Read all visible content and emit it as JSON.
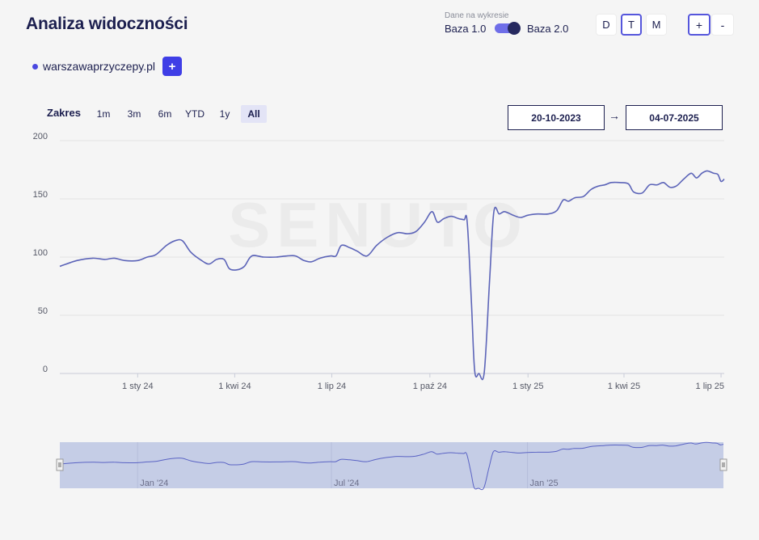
{
  "header": {
    "title": "Analiza widoczności",
    "data_toggle": {
      "caption": "Dane na wykresie",
      "left_label": "Baza 1.0",
      "right_label": "Baza 2.0",
      "selected": "Baza 2.0"
    },
    "period_buttons": [
      "D",
      "T",
      "M"
    ],
    "period_selected": "T",
    "zoom_in_label": "+",
    "zoom_out_label": "-"
  },
  "domains": [
    {
      "name": "warszawaprzyczepy.pl",
      "color": "#4a48e0"
    }
  ],
  "add_domain_label": "+",
  "range": {
    "label": "Zakres",
    "buttons": [
      "1m",
      "3m",
      "6m",
      "YTD",
      "1y",
      "All"
    ],
    "selected": "All",
    "from_date": "20-10-2023",
    "arrow": "→",
    "to_date": "04-07-2025"
  },
  "watermark": "SENUTO",
  "colors": {
    "accent": "#4a48e0",
    "line": "#5c64b8",
    "navigator_fill": "#c5cde6"
  },
  "chart_data": {
    "type": "line",
    "title": "",
    "xlabel": "",
    "ylabel": "",
    "ylim": [
      0,
      200
    ],
    "y_ticks": [
      0,
      50,
      100,
      150,
      200
    ],
    "x_range": [
      "2023-10-20",
      "2025-07-04"
    ],
    "x_ticks": [
      {
        "date": "2024-01-01",
        "label": "1 sty 24"
      },
      {
        "date": "2024-04-01",
        "label": "1 kwi 24"
      },
      {
        "date": "2024-07-01",
        "label": "1 lip 24"
      },
      {
        "date": "2024-10-01",
        "label": "1 paź 24"
      },
      {
        "date": "2025-01-01",
        "label": "1 sty 25"
      },
      {
        "date": "2025-04-01",
        "label": "1 kwi 25"
      },
      {
        "date": "2025-07-01",
        "label": "1 lip 25"
      }
    ],
    "grid": true,
    "series": [
      {
        "name": "warszawaprzyczepy.pl",
        "points": [
          [
            "2023-10-20",
            92
          ],
          [
            "2023-11-05",
            97
          ],
          [
            "2023-11-20",
            99
          ],
          [
            "2023-12-01",
            98
          ],
          [
            "2023-12-10",
            99
          ],
          [
            "2023-12-20",
            97
          ],
          [
            "2024-01-01",
            97
          ],
          [
            "2024-01-10",
            100
          ],
          [
            "2024-01-18",
            102
          ],
          [
            "2024-01-28",
            110
          ],
          [
            "2024-02-05",
            114
          ],
          [
            "2024-02-12",
            114
          ],
          [
            "2024-02-20",
            104
          ],
          [
            "2024-03-01",
            97
          ],
          [
            "2024-03-08",
            94
          ],
          [
            "2024-03-15",
            98
          ],
          [
            "2024-03-22",
            98
          ],
          [
            "2024-03-27",
            90
          ],
          [
            "2024-04-03",
            89
          ],
          [
            "2024-04-10",
            92
          ],
          [
            "2024-04-17",
            101
          ],
          [
            "2024-04-28",
            100
          ],
          [
            "2024-05-10",
            100
          ],
          [
            "2024-05-20",
            101
          ],
          [
            "2024-05-28",
            101
          ],
          [
            "2024-06-05",
            97
          ],
          [
            "2024-06-12",
            96
          ],
          [
            "2024-06-20",
            99
          ],
          [
            "2024-06-30",
            101
          ],
          [
            "2024-07-05",
            101
          ],
          [
            "2024-07-10",
            110
          ],
          [
            "2024-07-18",
            108
          ],
          [
            "2024-07-25",
            105
          ],
          [
            "2024-08-03",
            101
          ],
          [
            "2024-08-12",
            110
          ],
          [
            "2024-08-22",
            117
          ],
          [
            "2024-09-01",
            121
          ],
          [
            "2024-09-10",
            120
          ],
          [
            "2024-09-18",
            122
          ],
          [
            "2024-09-26",
            130
          ],
          [
            "2024-10-03",
            139
          ],
          [
            "2024-10-08",
            130
          ],
          [
            "2024-10-14",
            133
          ],
          [
            "2024-10-21",
            135
          ],
          [
            "2024-10-28",
            133
          ],
          [
            "2024-11-02",
            132
          ],
          [
            "2024-11-05",
            130
          ],
          [
            "2024-11-09",
            60
          ],
          [
            "2024-11-12",
            2
          ],
          [
            "2024-11-16",
            0
          ],
          [
            "2024-11-21",
            1
          ],
          [
            "2024-11-26",
            80
          ],
          [
            "2024-11-30",
            139
          ],
          [
            "2024-12-05",
            137
          ],
          [
            "2024-12-10",
            139
          ],
          [
            "2024-12-18",
            136
          ],
          [
            "2024-12-25",
            134
          ],
          [
            "2025-01-01",
            136
          ],
          [
            "2025-01-10",
            137
          ],
          [
            "2025-01-20",
            137
          ],
          [
            "2025-01-28",
            140
          ],
          [
            "2025-02-03",
            149
          ],
          [
            "2025-02-08",
            148
          ],
          [
            "2025-02-14",
            151
          ],
          [
            "2025-02-22",
            152
          ],
          [
            "2025-03-01",
            158
          ],
          [
            "2025-03-08",
            161
          ],
          [
            "2025-03-14",
            162
          ],
          [
            "2025-03-20",
            164
          ],
          [
            "2025-03-28",
            164
          ],
          [
            "2025-04-05",
            163
          ],
          [
            "2025-04-10",
            156
          ],
          [
            "2025-04-18",
            155
          ],
          [
            "2025-04-25",
            162
          ],
          [
            "2025-05-02",
            162
          ],
          [
            "2025-05-08",
            164
          ],
          [
            "2025-05-14",
            160
          ],
          [
            "2025-05-20",
            161
          ],
          [
            "2025-05-27",
            167
          ],
          [
            "2025-06-03",
            172
          ],
          [
            "2025-06-08",
            168
          ],
          [
            "2025-06-13",
            172
          ],
          [
            "2025-06-18",
            174
          ],
          [
            "2025-06-24",
            172
          ],
          [
            "2025-06-28",
            171
          ],
          [
            "2025-07-01",
            165
          ],
          [
            "2025-07-04",
            167
          ]
        ]
      }
    ],
    "navigator": {
      "range": [
        "2023-10-20",
        "2025-07-04"
      ],
      "ticks": [
        {
          "date": "2024-01-01",
          "label": "Jan '24"
        },
        {
          "date": "2024-07-01",
          "label": "Jul '24"
        },
        {
          "date": "2025-01-01",
          "label": "Jan '25"
        }
      ]
    }
  }
}
